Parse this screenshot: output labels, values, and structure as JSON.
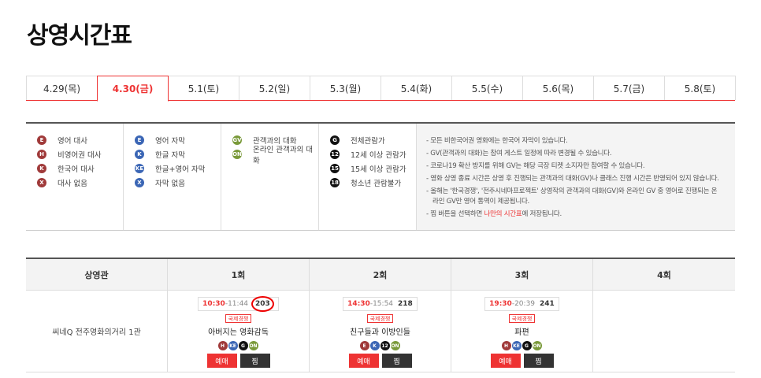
{
  "title": "상영시간표",
  "tabs": [
    "4.29(목)",
    "4.30(금)",
    "5.1(토)",
    "5.2(일)",
    "5.3(월)",
    "5.4(화)",
    "5.5(수)",
    "5.6(목)",
    "5.7(금)",
    "5.8(토)"
  ],
  "legend": {
    "col1": [
      {
        "sym": "E",
        "text": "영어 대사"
      },
      {
        "sym": "H",
        "text": "비영어권 대사"
      },
      {
        "sym": "K",
        "text": "한국어 대사"
      },
      {
        "sym": "X",
        "text": "대사 없음"
      }
    ],
    "col2": [
      {
        "sym": "E",
        "text": "영어 자막"
      },
      {
        "sym": "K",
        "text": "한글 자막"
      },
      {
        "sym": "KE",
        "text": "한글+영어 자막"
      },
      {
        "sym": "X",
        "text": "자막 없음"
      }
    ],
    "col3": [
      {
        "sym": "GV",
        "text": "관객과의 대화"
      },
      {
        "sym": "ON",
        "text": "온라인 관객과의 대화"
      }
    ],
    "col4": [
      {
        "sym": "G",
        "text": "전체관람가"
      },
      {
        "sym": "12",
        "text": "12세 이상 관람가"
      },
      {
        "sym": "15",
        "text": "15세 이상 관람가"
      },
      {
        "sym": "18",
        "text": "청소년 관람불가"
      }
    ],
    "notes": [
      "- 모든 비한국어권 영화에는 한국어 자막이 있습니다.",
      "- GV(관객과의 대화)는 참여 게스트 일정에 따라 변경될 수 있습니다.",
      "- 코로나19 확산 방지를 위해 GV는 해당 극장 티켓 소지자만 참여할 수 있습니다.",
      "- 영화 상영 종료 시간은 상영 후 진행되는 관객과의 대화(GV)나 클래스 진행 시간은 반영되어 있지 않습니다.",
      "- 올해는 '한국경쟁', '전주시네마프로젝트' 상영작의 관객과의 대화(GV)와 온라인 GV 중 영어로 진행되는 온",
      "  라인 GV만 영어 통역이 제공됩니다."
    ],
    "last_note_pre": "- 찜 버튼을 선택하면 ",
    "last_note_hl": "나만의 시간표",
    "last_note_post": "에 저장됩니다."
  },
  "schedule": {
    "headers": [
      "상영관",
      "1회",
      "2회",
      "3회",
      "4회"
    ],
    "theater": "씨네Q 전주영화의거리 1관",
    "shows": [
      {
        "start": "10:30",
        "end": "11:44",
        "seats": "203",
        "comp": "국제경쟁",
        "title": "아버지는 영화감독",
        "badges": [
          "H",
          "KE",
          "G",
          "ON"
        ]
      },
      {
        "start": "14:30",
        "end": "15:54",
        "seats": "218",
        "comp": "국제경쟁",
        "title": "친구들과 이방인들",
        "badges": [
          "E",
          "K",
          "12",
          "ON"
        ]
      },
      {
        "start": "19:30",
        "end": "20:39",
        "seats": "241",
        "comp": "국제경쟁",
        "title": "파편",
        "badges": [
          "H",
          "KE",
          "G",
          "ON"
        ]
      }
    ],
    "book_label": "예매",
    "fav_label": "찜",
    "time_sep": "-"
  },
  "colors": {
    "accent": "#ee3333",
    "dialogue": "#a03a3a",
    "subtitle": "#3b66b5",
    "gv": "#7a9a3a",
    "rating": "#111111"
  }
}
